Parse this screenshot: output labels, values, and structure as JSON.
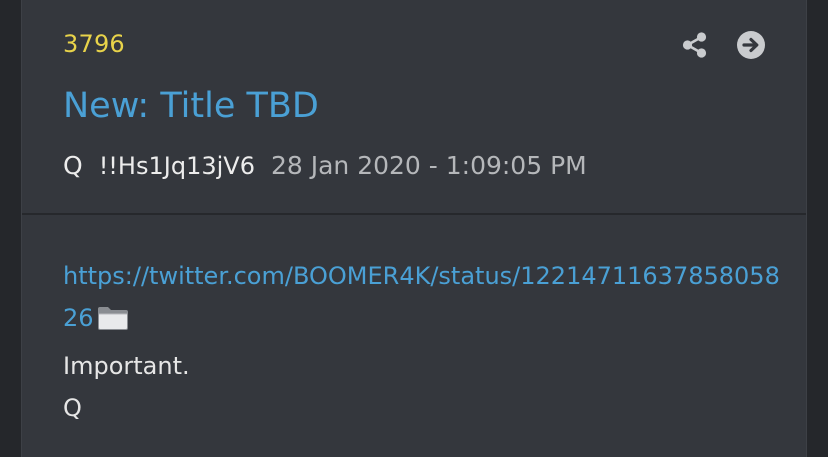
{
  "post": {
    "number": "3796",
    "title": "New: Title TBD",
    "author": "Q",
    "tripcode": "!!Hs1Jq13jV6",
    "timestamp": "28 Jan 2020 - 1:09:05 PM",
    "link_text": "https://twitter.com/BOOMER4K/status/1221471163785805826",
    "lines": [
      "Important.",
      "Q"
    ]
  },
  "icons": {
    "share": "share-icon",
    "open": "arrow-right-circle-icon",
    "folder": "folder-icon"
  },
  "colors": {
    "background": "#25272b",
    "card": "#34373d",
    "post_number": "#e8d34a",
    "link": "#4aa0d5",
    "text": "#e6e6e6",
    "muted": "#b5b7ba"
  }
}
